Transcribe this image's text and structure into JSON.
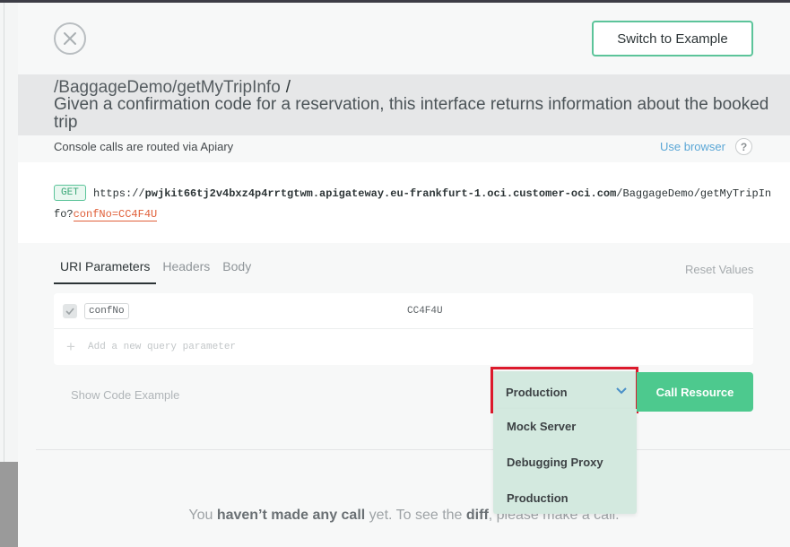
{
  "header": {
    "switch_label": "Switch to Example"
  },
  "resource": {
    "path": "/BaggageDemo/getMyTripInfo",
    "path_suffix": "/",
    "description": "Given a confirmation code for a reservation, this interface returns information about the booked trip"
  },
  "console": {
    "routed_text": "Console calls are routed via Apiary",
    "use_browser": "Use browser",
    "help": "?"
  },
  "request": {
    "method": "GET",
    "url_prefix": "https://",
    "url_host": "pwjkit66tj2v4bxz4p4rrtgtwm.apigateway.eu-frankfurt-1.oci.customer-oci.com",
    "url_path_part1": "/BaggageDemo/getMyTripIn",
    "url_path_part2": "fo?",
    "url_query": "confNo=CC4F4U"
  },
  "tabs": [
    {
      "label": "URI Parameters",
      "active": true
    },
    {
      "label": "Headers",
      "active": false
    },
    {
      "label": "Body",
      "active": false
    }
  ],
  "reset_values": "Reset Values",
  "parameters": [
    {
      "name": "confNo",
      "value": "CC4F4U",
      "checked": true
    }
  ],
  "add_parameter_placeholder": "Add a new query parameter",
  "show_code_example": "Show Code Example",
  "environment": {
    "selected": "Production",
    "options": [
      "Mock Server",
      "Debugging Proxy",
      "Production"
    ]
  },
  "call_resource": "Call Resource",
  "empty_message": {
    "part1": "You ",
    "bold1": "haven’t made any call",
    "part2": " yet. To see the ",
    "bold2": "diff",
    "part3": ", please make a call."
  },
  "colors": {
    "accent_green": "#4dc98e",
    "dropdown_bg": "#d3e9df",
    "highlight_red": "#dc1a2c",
    "link_blue": "#5ba7d6"
  }
}
